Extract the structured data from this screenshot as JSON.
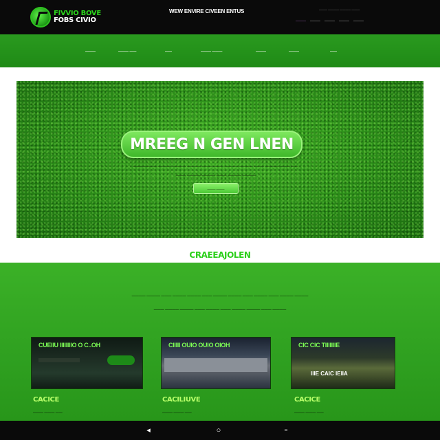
{
  "header": {
    "logo_line1": "FIVVIO BOVE",
    "logo_line2": "FOBS CIVIO",
    "tagline": "WEW ENVIRE CIVEEN ENTUS",
    "utility_top": "——— ———— ———— ———",
    "utility_links": [
      "———",
      "———",
      "———",
      "———",
      "———"
    ]
  },
  "nav": {
    "items": [
      "———",
      "——— ——",
      "——",
      "——— ———",
      "———",
      "———",
      "——"
    ]
  },
  "hero": {
    "title": "MREEG N GEN LNEN",
    "subtitle_line1": "——————— ———— ———— ———— ——— ——— ———— ———— ——— ———— ——— ——",
    "subtitle_line2": "——— ———— ———— ——— ———— ————",
    "button_label": "——— ———"
  },
  "section": {
    "title": "CRAEEAJOLEN",
    "text_line1": "———— ———— ——— ———— ———— ——— ———— ———— ——— ———— ——— ———— ————",
    "text_line2": "——— ———— ———— ——— ———— ——— ———— ———— ——— ————"
  },
  "cards": [
    {
      "label": "CUEIIU IIIIIIIIO O C..OH",
      "caption": "CACICE",
      "caption_sub": "——— ——— ——"
    },
    {
      "label": "CIIIII OUIO OUIO OIOH",
      "caption": "CACILIUVE",
      "caption_sub": "——— ——— ——"
    },
    {
      "label": "CIC CIC TIIIIIIIE",
      "label2": "IIIE CAIC IEIIA",
      "caption": "CACICE",
      "caption_sub": "——— ——— ——"
    }
  ],
  "footer": {
    "icons": [
      "signal-icon",
      "circle-icon",
      "square-icon"
    ]
  },
  "colors": {
    "brand_green": "#2bcf1a",
    "nav_green": "#2a9a1f",
    "header_black": "#0a0a0a",
    "hero_button": "#4bc935"
  }
}
